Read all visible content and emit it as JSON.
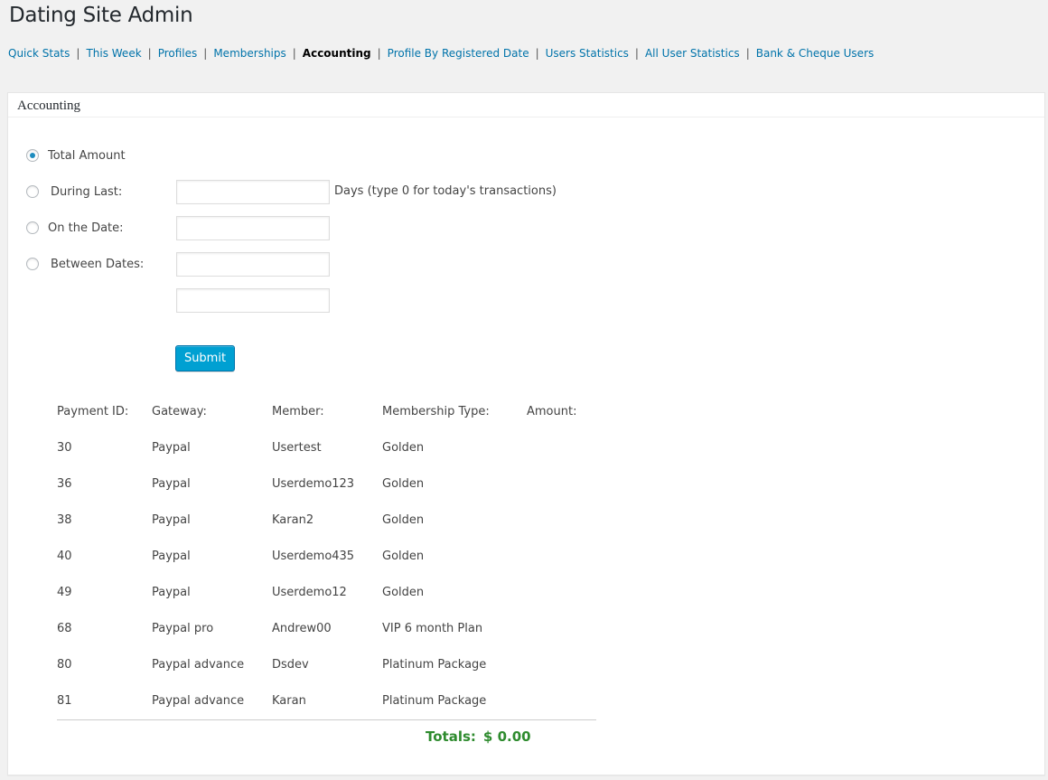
{
  "page": {
    "title": "Dating Site Admin"
  },
  "nav": {
    "items": [
      {
        "label": "Quick Stats",
        "current": false
      },
      {
        "label": "This Week",
        "current": false
      },
      {
        "label": "Profiles",
        "current": false
      },
      {
        "label": "Memberships",
        "current": false
      },
      {
        "label": "Accounting",
        "current": true
      },
      {
        "label": "Profile By Registered Date",
        "current": false
      },
      {
        "label": "Users Statistics",
        "current": false
      },
      {
        "label": "All User Statistics",
        "current": false
      },
      {
        "label": "Bank & Cheque Users",
        "current": false
      }
    ],
    "separator": "|"
  },
  "panel": {
    "title": "Accounting"
  },
  "filters": {
    "total_amount": {
      "label": "Total Amount",
      "checked": true
    },
    "during_last": {
      "label": "During Last:",
      "checked": false,
      "value": "",
      "hint": "Days (type 0 for today's transactions)"
    },
    "on_date": {
      "label": "On the Date:",
      "checked": false,
      "value": ""
    },
    "between_dates": {
      "label": "Between Dates:",
      "checked": false,
      "from_value": "",
      "to_value": ""
    },
    "submit_label": "Submit"
  },
  "table": {
    "headers": [
      "Payment ID:",
      "Gateway:",
      "Member:",
      "Membership Type:",
      "Amount:"
    ],
    "rows": [
      [
        "30",
        "Paypal",
        "Usertest",
        "Golden",
        ""
      ],
      [
        "36",
        "Paypal",
        "Userdemo123",
        "Golden",
        ""
      ],
      [
        "38",
        "Paypal",
        "Karan2",
        "Golden",
        ""
      ],
      [
        "40",
        "Paypal",
        "Userdemo435",
        "Golden",
        ""
      ],
      [
        "49",
        "Paypal",
        "Userdemo12",
        "Golden",
        ""
      ],
      [
        "68",
        "Paypal pro",
        "Andrew00",
        "VIP 6 month Plan",
        ""
      ],
      [
        "80",
        "Paypal advance",
        "Dsdev",
        "Platinum Package",
        ""
      ],
      [
        "81",
        "Paypal advance",
        "Karan",
        "Platinum Package",
        ""
      ]
    ]
  },
  "totals": {
    "label": "Totals:",
    "amount": "$ 0.00"
  },
  "colors": {
    "link": "#0073aa",
    "button": "#00a0d2",
    "totals": "#2e8b2e",
    "radio_dot": "#1e8cbe"
  }
}
